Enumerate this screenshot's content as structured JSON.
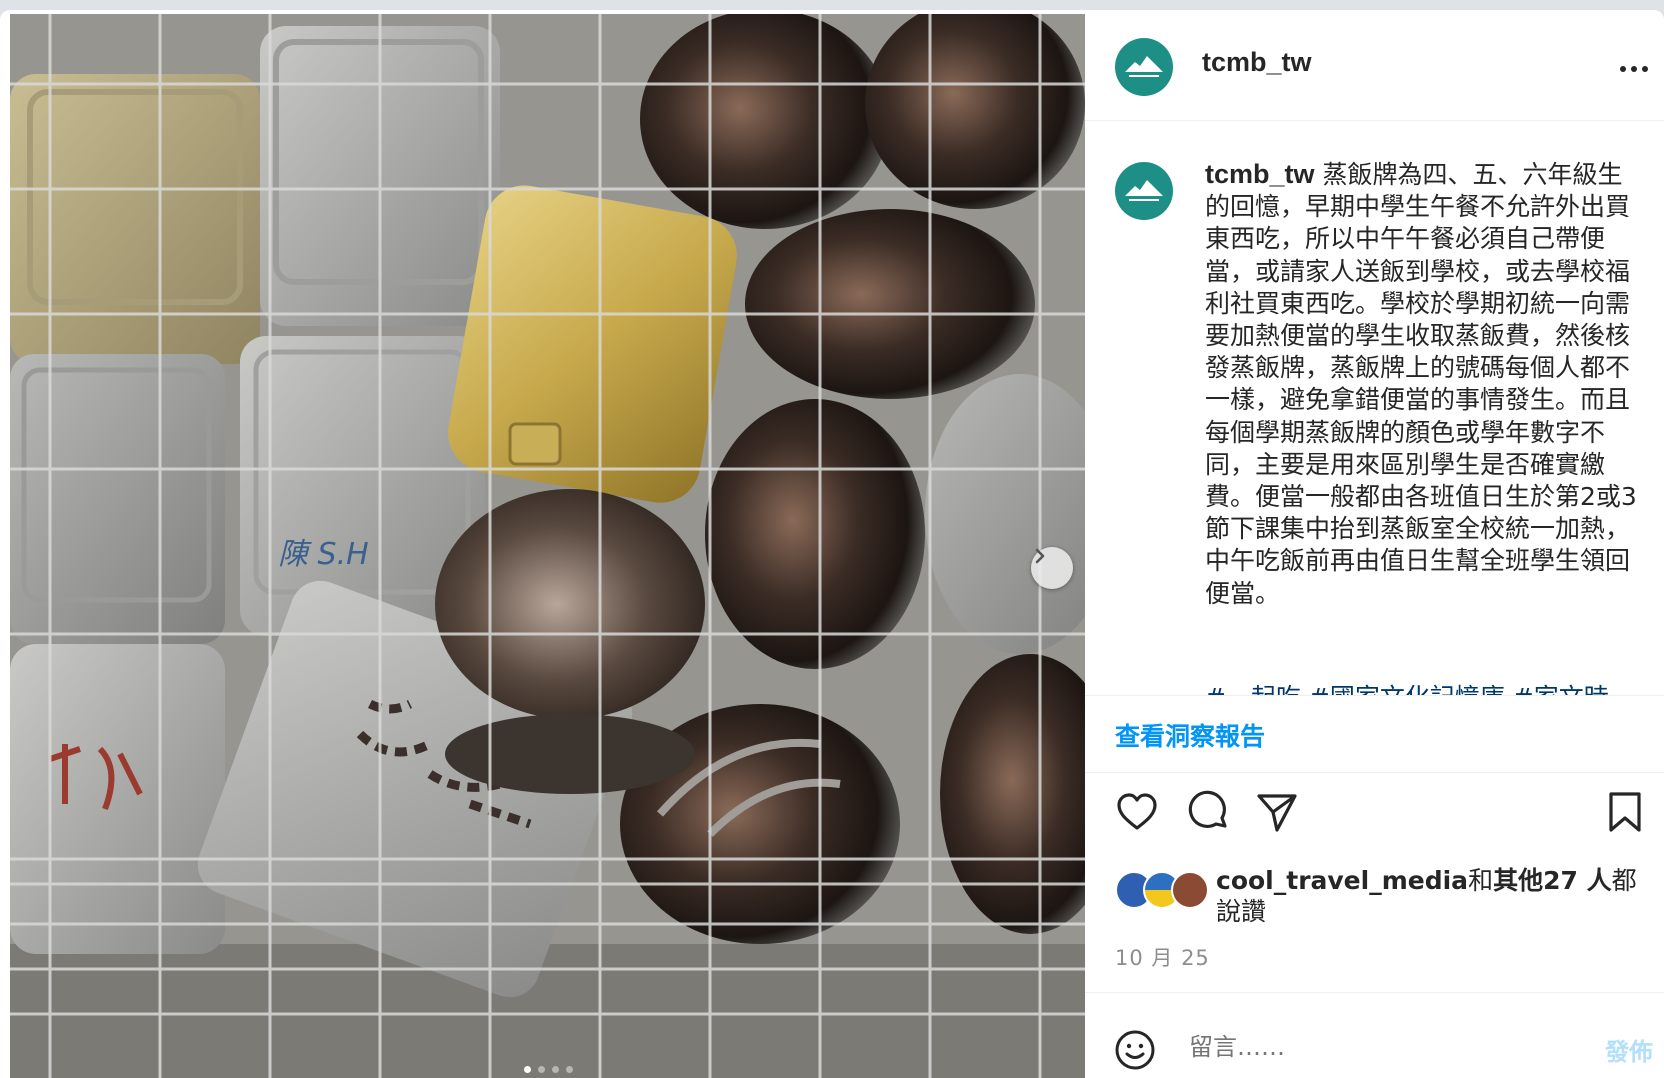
{
  "post": {
    "username": "tcmb_tw",
    "caption": "蒸飯牌為四、五、六年級生的回憶，早期中學生午餐不允許外出買東西吃，所以中午午餐必須自己帶便當，或請家人送飯到學校，或去學校福利社買東西吃。學校於學期初統一向需要加熱便當的學生收取蒸飯費，然後核發蒸飯牌，蒸飯牌上的號碼每個人都不一樣，避免拿錯便當的事情發生。而且每個學期蒸飯牌的顏色或學年數字不同，主要是用來區別學生是否確實繳費。便當一般都由各班值日生於第2或3節下課集中抬到蒸飯室全校統一加熱，中午吃飯前再由值日生幫全班學生領回便當。",
    "hashtags": "#一起吃 #國家文化記憶庫 #家文時",
    "insights_label": "查看洞察報告",
    "likes": {
      "user": "cool_travel_media",
      "connector": "和",
      "others": "其他27 人",
      "suffix": "都說讚"
    },
    "date": "10 月 25",
    "comment_placeholder": "留言……",
    "post_label": "發佈"
  },
  "carousel": {
    "slide_count": 4,
    "active_index": 0
  },
  "photo": {
    "labels": [
      "陳 S.H"
    ]
  },
  "icons": {
    "actions": [
      "heart-icon",
      "comment-icon",
      "share-icon",
      "bookmark-icon"
    ],
    "emoji": "emoji-icon",
    "more": "more-options-icon",
    "next": "chevron-right-icon"
  },
  "colors": {
    "brand": "#1e8f86",
    "link": "#00376b",
    "accent": "#0095f6",
    "muted": "#8e8e8e",
    "text": "#262626"
  }
}
